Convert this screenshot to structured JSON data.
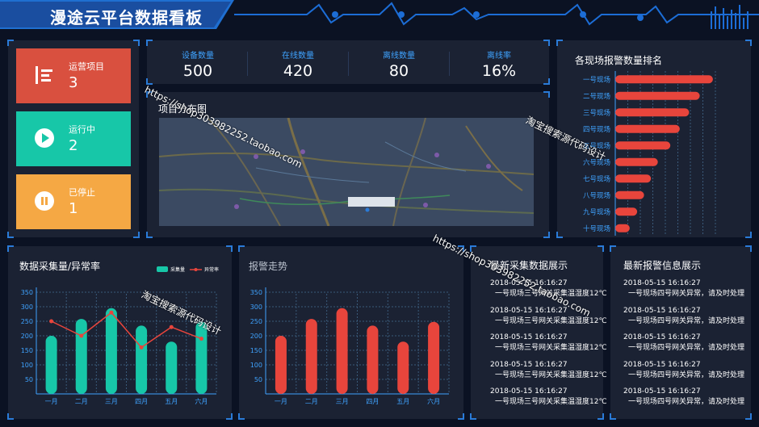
{
  "header": {
    "title": "漫途云平台数据看板"
  },
  "status_cards": [
    {
      "label": "运营项目",
      "value": "3",
      "color": "#d9503f",
      "icon": "list-icon"
    },
    {
      "label": "运行中",
      "value": "2",
      "color": "#17c7a8",
      "icon": "play-icon"
    },
    {
      "label": "已停止",
      "value": "1",
      "color": "#f5a844",
      "icon": "pause-icon"
    }
  ],
  "kpis": [
    {
      "label": "设备数量",
      "value": "500"
    },
    {
      "label": "在线数量",
      "value": "420"
    },
    {
      "label": "离线数量",
      "value": "80"
    },
    {
      "label": "离线率",
      "value": "16%"
    }
  ],
  "map_panel": {
    "title": "项目分布图"
  },
  "alarm_rank": {
    "title": "各现场报警数量排名",
    "chart_data": {
      "type": "bar",
      "orientation": "horizontal",
      "categories": [
        "一号现场",
        "二号现场",
        "三号现场",
        "四号现场",
        "五号现场",
        "六号现场",
        "七号现场",
        "八号现场",
        "九号现场",
        "十号现场"
      ],
      "values": [
        156,
        135,
        118,
        103,
        88,
        68,
        57,
        46,
        35,
        23
      ],
      "xticks": [
        "0",
        "20",
        "40",
        "60",
        "80",
        "100",
        "120",
        "140",
        "160"
      ],
      "xlim": [
        0,
        160
      ],
      "color": "#e8453c"
    }
  },
  "collect_chart": {
    "title": "数据采集量/异常率",
    "chart_data": {
      "type": "bar",
      "categories": [
        "一月",
        "二月",
        "三月",
        "四月",
        "五月",
        "六月"
      ],
      "yticks": [
        "350",
        "300",
        "250",
        "200",
        "150",
        "100",
        "50"
      ],
      "ylim": [
        0,
        350
      ],
      "series": [
        {
          "name": "采集量",
          "type": "bar",
          "color": "#17c7a8",
          "values": [
            200,
            258,
            295,
            235,
            180,
            248
          ]
        },
        {
          "name": "异常率",
          "type": "line",
          "color": "#e8453c",
          "values": [
            250,
            200,
            280,
            160,
            230,
            190
          ]
        }
      ]
    }
  },
  "alarm_trend": {
    "title": "报警走势",
    "chart_data": {
      "type": "bar",
      "categories": [
        "一月",
        "二月",
        "三月",
        "四月",
        "五月",
        "六月"
      ],
      "yticks": [
        "350",
        "300",
        "250",
        "200",
        "150",
        "100",
        "50"
      ],
      "ylim": [
        0,
        350
      ],
      "values": [
        200,
        258,
        295,
        235,
        180,
        248
      ],
      "color": "#e8453c"
    }
  },
  "latest_collect": {
    "title": "最新采集数据展示",
    "items": [
      {
        "time": "2018-05-15 16:16:27",
        "text": "一号现场三号网关采集温湿度12℃"
      },
      {
        "time": "2018-05-15 16:16:27",
        "text": "一号现场三号网关采集温湿度12℃"
      },
      {
        "time": "2018-05-15 16:16:27",
        "text": "一号现场三号网关采集温湿度12℃"
      },
      {
        "time": "2018-05-15 16:16:27",
        "text": "一号现场三号网关采集温湿度12℃"
      },
      {
        "time": "2018-05-15 16:16:27",
        "text": "一号现场三号网关采集温湿度12℃"
      }
    ]
  },
  "latest_alarm": {
    "title": "最新报警信息展示",
    "items": [
      {
        "time": "2018-05-15 16:16:27",
        "text": "一号现场四号网关异常，请及时处理"
      },
      {
        "time": "2018-05-15 16:16:27",
        "text": "一号现场四号网关异常，请及时处理"
      },
      {
        "time": "2018-05-15 16:16:27",
        "text": "一号现场四号网关异常，请及时处理"
      },
      {
        "time": "2018-05-15 16:16:27",
        "text": "一号现场四号网关异常，请及时处理"
      },
      {
        "time": "2018-05-15 16:16:27",
        "text": "一号现场四号网关异常，请及时处理"
      }
    ]
  },
  "watermarks": [
    "https://shop303982252.taobao.com",
    "淘宝搜索源代码设计",
    "https://shop303982252.taobao.com",
    "淘宝搜索源代码设计"
  ]
}
